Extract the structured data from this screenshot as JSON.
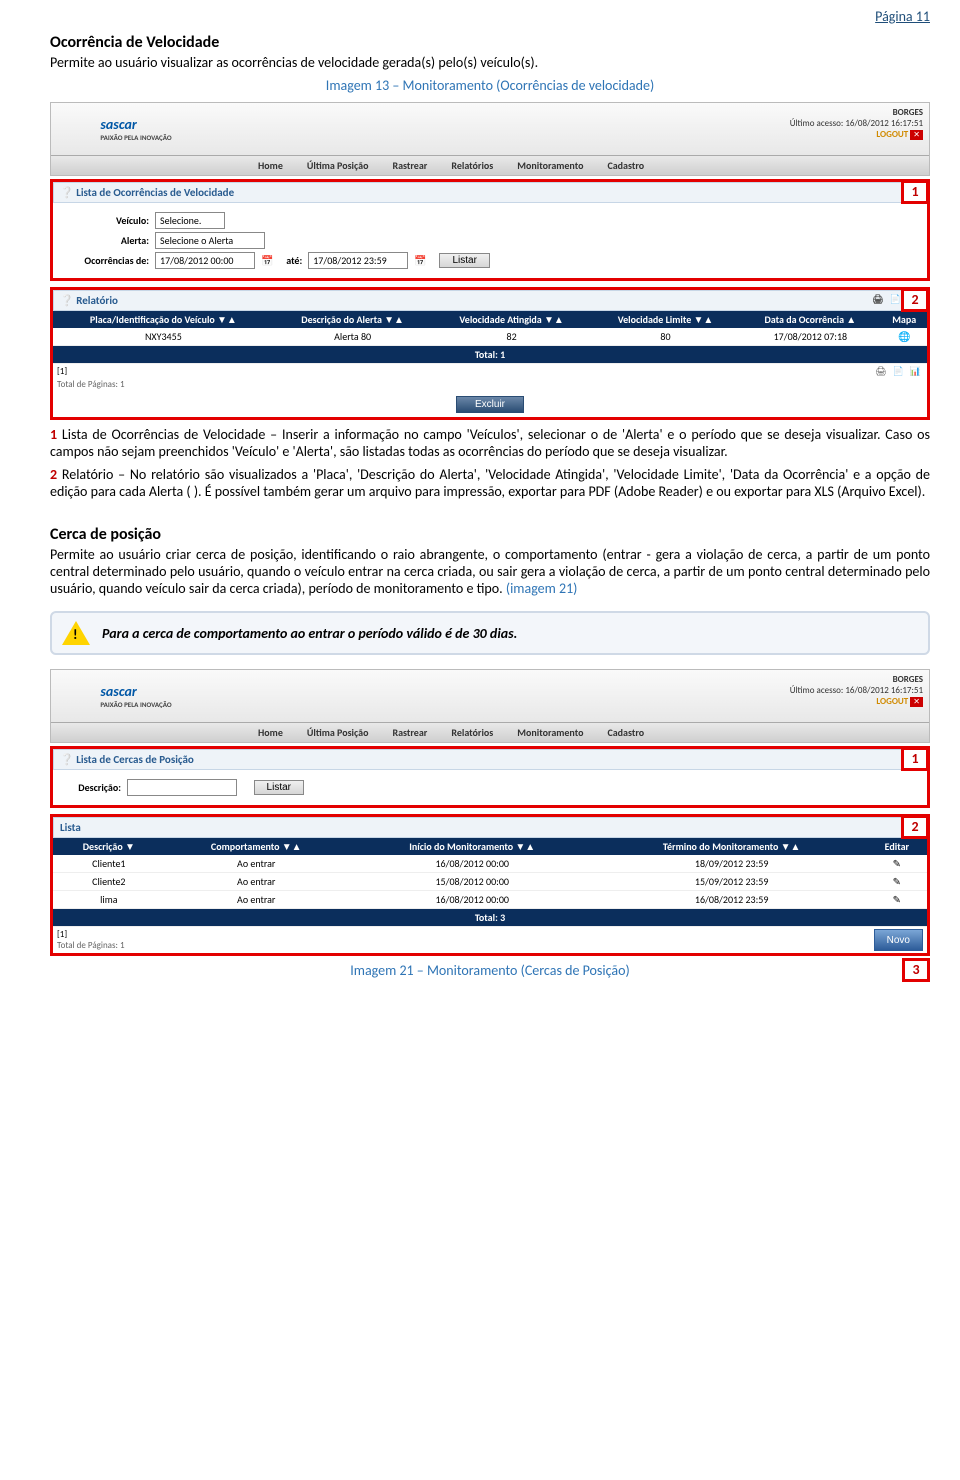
{
  "page_no": "Página 11",
  "sec1": {
    "title": "Ocorrência de Velocidade",
    "desc": "Permite ao usuário visualizar as ocorrências de velocidade gerada(s) pelo(s) veículo(s).",
    "caption": "Imagem 13 – Monitoramento (Ocorrências de velocidade)"
  },
  "app": {
    "logo": "sascar",
    "logo_sub": "PAIXÃO PELA INOVAÇÃO",
    "user": "BORGES",
    "last": "Último acesso: 16/08/2012 16:17:51",
    "logout": "LOGOUT",
    "nav": [
      "Home",
      "Última Posição",
      "Rastrear",
      "Relatórios",
      "Monitoramento",
      "Cadastro"
    ]
  },
  "form1": {
    "header": "Lista de Ocorrências de Velocidade",
    "l_veiculo": "Veículo:",
    "veic_opt": "Selecione.",
    "l_alerta": "Alerta:",
    "alerta_opt": "Selecione o Alerta",
    "l_occ": "Ocorrências de:",
    "d1": "17/08/2012 00:00",
    "l_ate": "até:",
    "d2": "17/08/2012 23:59",
    "btn": "Listar"
  },
  "report1": {
    "header": "Relatório",
    "cols": [
      "Placa/Identificação do Veículo ▼▲",
      "Descrição do Alerta ▼▲",
      "Velocidade Atingida ▼▲",
      "Velocidade Limite ▼▲",
      "Data da Ocorrência ▲",
      "Mapa"
    ],
    "row": [
      "NXY3455",
      "Alerta 80",
      "82",
      "80",
      "17/08/2012 07:18",
      "🌐"
    ],
    "total": "Total: 1",
    "pages": "[1]",
    "pgcount": "Total de Páginas: 1",
    "excluir": "Excluir"
  },
  "body1_1a": "1",
  "body1_1b": " Lista de Ocorrências de Velocidade – Inserir a informação no campo 'Veículos', selecionar o de 'Alerta' e o período que se deseja visualizar. Caso os campos não sejam preenchidos 'Veículo' e 'Alerta', são listadas todas as ocorrências do período que se deseja visualizar.",
  "body1_2a": "2",
  "body1_2b": " Relatório – No relatório são visualizados a 'Placa', 'Descrição do Alerta', 'Velocidade Atingida', 'Velocidade Limite', 'Data da Ocorrência' e a opção de edição para cada Alerta ( ). É possível também gerar um arquivo para impressão, exportar para PDF (Adobe Reader) e ou exportar para XLS (Arquivo Excel).",
  "sec2": {
    "title": "Cerca de posição",
    "desc": "Permite ao usuário criar cerca de posição, identificando o raio abrangente, o comportamento (entrar - gera a violação de cerca, a partir de um ponto central determinado pelo usuário, quando o veículo entrar na cerca criada, ou sair gera a violação de cerca, a partir de um ponto central determinado pelo usuário, quando veículo sair da cerca criada), período de monitoramento e tipo. ",
    "ref": "(imagem 21)"
  },
  "note": "Para a cerca de comportamento ao entrar o período válido é de 30 dias.",
  "form2": {
    "header": "Lista de Cercas de Posição",
    "l_desc": "Descrição:",
    "btn": "Listar"
  },
  "list2": {
    "header": "Lista",
    "cols": [
      "Descrição ▼",
      "Comportamento ▼▲",
      "Início do Monitoramento ▼▲",
      "Término do Monitoramento ▼▲",
      "Editar"
    ],
    "rows": [
      [
        "Cliente1",
        "Ao entrar",
        "16/08/2012 00:00",
        "18/09/2012 23:59",
        "✎"
      ],
      [
        "Cliente2",
        "Ao entrar",
        "15/08/2012 00:00",
        "15/09/2012 23:59",
        "✎"
      ],
      [
        "lima",
        "Ao entrar",
        "16/08/2012 00:00",
        "16/08/2012 23:59",
        "✎"
      ]
    ],
    "total": "Total: 3",
    "pages": "[1]",
    "pgcount": "Total de Páginas: 1",
    "novo": "Novo"
  },
  "caption2": "Imagem 21 – Monitoramento (Cercas de Posição)",
  "tag3": "3"
}
